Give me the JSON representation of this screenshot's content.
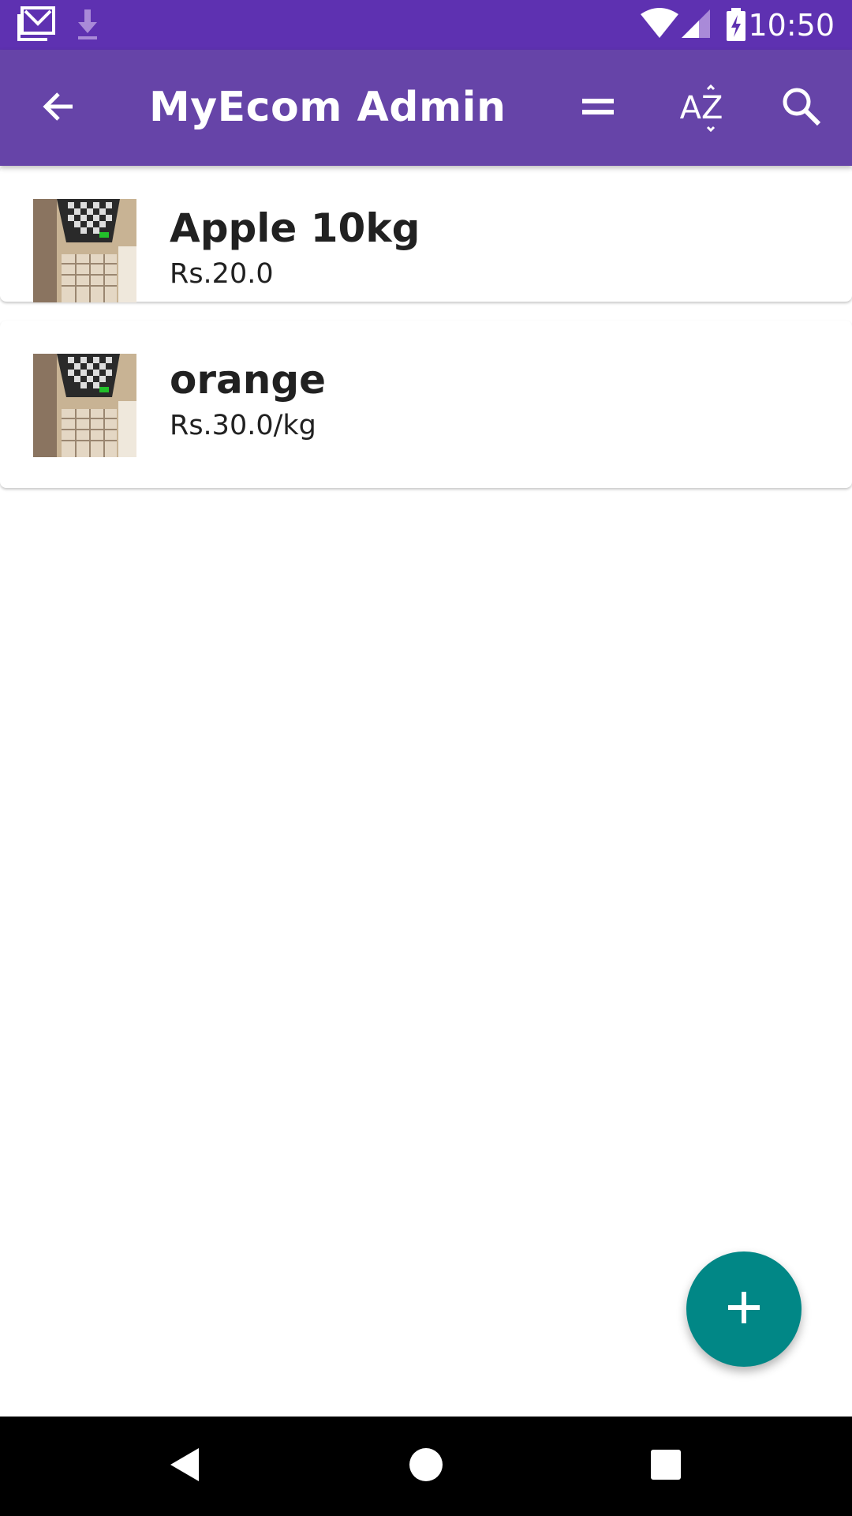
{
  "status_bar": {
    "time": "10:50",
    "icons": [
      "gmail-icon",
      "download-icon",
      "wifi-icon",
      "cell-signal-icon",
      "battery-charging-icon"
    ]
  },
  "app_bar": {
    "title": "MyEcom Admin",
    "icons": [
      "back-arrow-icon",
      "equals-icon",
      "sort-az-icon",
      "search-icon"
    ],
    "sort_label": "AZ"
  },
  "products": [
    {
      "name": "Apple 10kg",
      "price": "Rs.20.0"
    },
    {
      "name": "orange",
      "price": "Rs.30.0/kg"
    }
  ],
  "fab": {
    "icon": "plus-icon"
  },
  "nav_bar": {
    "icons": [
      "back-triangle-icon",
      "home-circle-icon",
      "recents-square-icon"
    ]
  },
  "colors": {
    "status_bar": "#5e31b1",
    "app_bar": "#6644a8",
    "fab": "#018786",
    "nav_bar": "#000000"
  }
}
